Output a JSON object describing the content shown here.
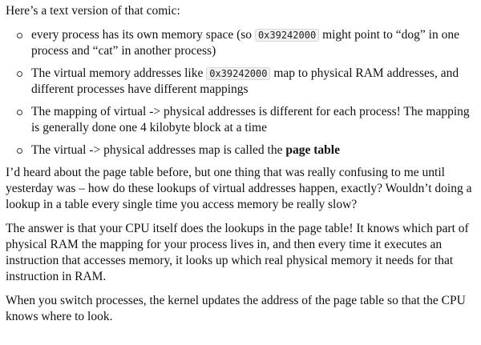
{
  "intro": "Here’s a text version of that comic:",
  "bullets": [
    {
      "pre": "every process has its own memory space (so ",
      "code": "0x39242000",
      "post": " might point to “dog” in one process and “cat” in another process)"
    },
    {
      "pre": "The virtual memory addresses like ",
      "code": "0x39242000",
      "post": " map to physical RAM addresses, and different processes have different mappings"
    },
    {
      "text": "The mapping of virtual -> physical addresses is different for each process! The mapping is generally done one 4 kilobyte block at a time"
    },
    {
      "pre": "The virtual -> physical addresses map is called the ",
      "bold": "page table"
    }
  ],
  "paragraphs": [
    "I’d heard about the page table before, but one thing that was really confusing to me until yesterday was – how do these lookups of virtual addresses happen, exactly? Wouldn’t doing a lookup in a table every single time you access memory be really slow?",
    "The answer is that your CPU itself does the lookups in the page table! It knows which part of physical RAM the mapping for your process lives in, and then every time it executes an instruction that accesses memory, it looks up which real physical memory it needs for that instruction in RAM.",
    "When you switch processes, the kernel updates the address of the page table so that the CPU knows where to look."
  ]
}
